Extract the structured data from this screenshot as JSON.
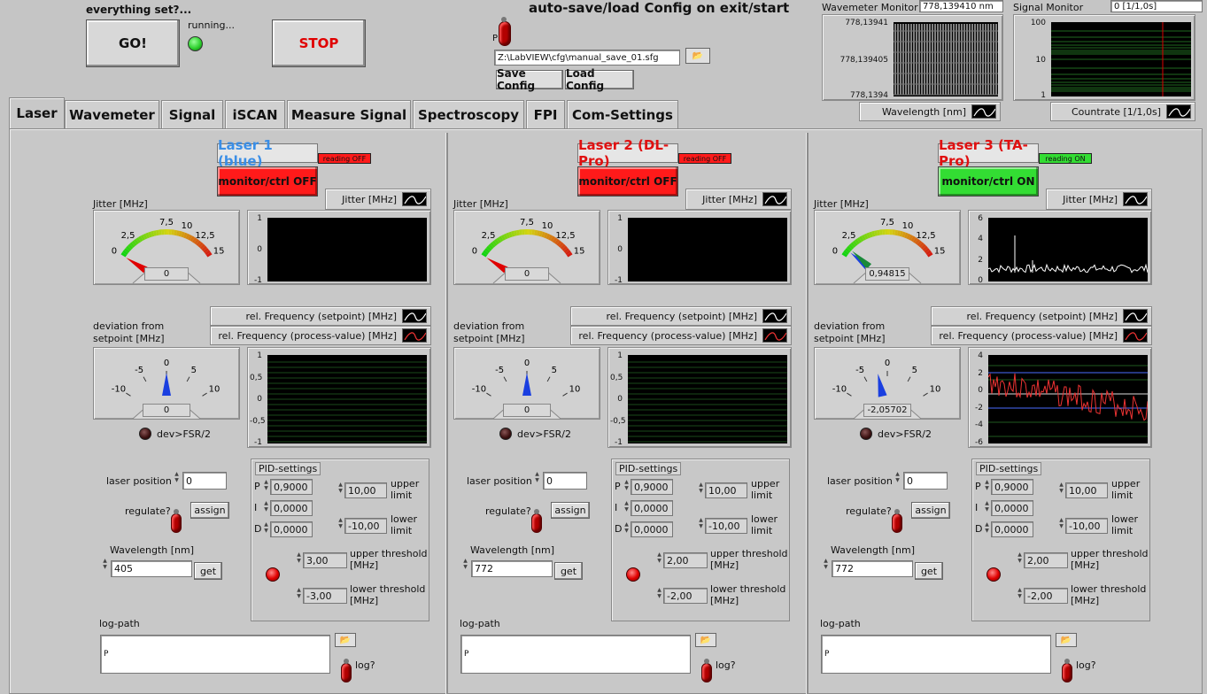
{
  "top": {
    "everything_set_label": "everything set?...",
    "go_label": "GO!",
    "running_label": "running...",
    "stop_label": "STOP",
    "autosave_title": "auto-save/load Config on exit/start",
    "config_path": "Z:\\LabVIEW\\cfg\\manual_save_01.sfg",
    "save_config_label": "Save Config",
    "load_config_label": "Load Config",
    "path_prefix_label": "P"
  },
  "wavemeter_monitor": {
    "title": "Wavemeter Monitor",
    "value": "778,139410 nm",
    "yticks": [
      "778,13941",
      "778,139405",
      "778,1394"
    ],
    "legend": "Wavelength [nm]"
  },
  "signal_monitor": {
    "title": "Signal Monitor",
    "value": "0 [1/1,0s]",
    "yticks": [
      "100",
      "10",
      "1"
    ],
    "legend": "Countrate [1/1,0s]"
  },
  "tabs": [
    "Laser",
    "Wavemeter",
    "Signal",
    "iSCAN",
    "Measure Signal",
    "Spectroscopy",
    "FPI",
    "Com-Settings"
  ],
  "common": {
    "reading_off": "reading OFF",
    "reading_on": "reading ON",
    "monitor_off": "monitor/ctrl OFF",
    "monitor_on": "monitor/ctrl ON",
    "jitter_label": "Jitter [MHz]",
    "jitter_legend": "Jitter [MHz]",
    "deviation_label": "deviation from setpoint [MHz]",
    "rel_setpoint": "rel. Frequency (setpoint) [MHz]",
    "rel_process": "rel. Frequency (process-value) [MHz]",
    "dev_fsr": "dev>FSR/2",
    "laser_position": "laser position",
    "regulate": "regulate?",
    "assign": "assign",
    "wavelength_label": "Wavelength [nm]",
    "get": "get",
    "pid_settings": "PID-settings",
    "p": "P",
    "i": "I",
    "d": "D",
    "upper_limit": "upper limit",
    "lower_limit": "lower limit",
    "upper_threshold": "upper threshold [MHz]",
    "lower_threshold": "lower threshold [MHz]",
    "log_path": "log-path",
    "log": "log?",
    "path_prefix": "P",
    "jitter_ticks": [
      "0",
      "2,5",
      "7,5",
      "10",
      "12,5",
      "15"
    ],
    "dev_ticks": [
      "-10",
      "-5",
      "0",
      "5",
      "10"
    ]
  },
  "lasers": [
    {
      "name": "Laser 1 (blue)",
      "name_color": "#3a8ee6",
      "reading": "reading OFF",
      "monitor": "monitor/ctrl OFF",
      "jitter_value": "0",
      "jitter_yticks": [
        "1",
        "0",
        "-1"
      ],
      "dev_value": "0",
      "dev_yticks": [
        "1",
        "0,5",
        "0",
        "-0,5",
        "-1"
      ],
      "laser_position": "0",
      "wavelength": "405",
      "p": "0,9000",
      "i": "0,0000",
      "d": "0,0000",
      "upper_limit": "10,00",
      "lower_limit": "-10,00",
      "upper_threshold": "3,00",
      "lower_threshold": "-3,00"
    },
    {
      "name": "Laser 2 (DL-Pro)",
      "name_color": "#e01010",
      "reading": "reading OFF",
      "monitor": "monitor/ctrl OFF",
      "jitter_value": "0",
      "jitter_yticks": [
        "1",
        "0",
        "-1"
      ],
      "dev_value": "0",
      "dev_yticks": [
        "1",
        "0,5",
        "0",
        "-0,5",
        "-1"
      ],
      "laser_position": "0",
      "wavelength": "772",
      "p": "0,9000",
      "i": "0,0000",
      "d": "0,0000",
      "upper_limit": "10,00",
      "lower_limit": "-10,00",
      "upper_threshold": "2,00",
      "lower_threshold": "-2,00"
    },
    {
      "name": "Laser 3 (TA-Pro)",
      "name_color": "#e01010",
      "reading": "reading ON",
      "monitor": "monitor/ctrl ON",
      "jitter_value": "0,94815",
      "jitter_yticks": [
        "6",
        "4",
        "2",
        "0"
      ],
      "dev_value": "-2,05702",
      "dev_yticks": [
        "4",
        "2",
        "0",
        "-2",
        "-4",
        "-6"
      ],
      "laser_position": "0",
      "wavelength": "772",
      "p": "0,9000",
      "i": "0,0000",
      "d": "0,0000",
      "upper_limit": "10,00",
      "lower_limit": "-10,00",
      "upper_threshold": "2,00",
      "lower_threshold": "-2,00"
    }
  ],
  "colors": {
    "led_green": "#2fd12f",
    "led_red": "#e00000",
    "state_off": "#ff1a1a",
    "state_on": "#33dd33",
    "plot_bg": "#000000"
  }
}
